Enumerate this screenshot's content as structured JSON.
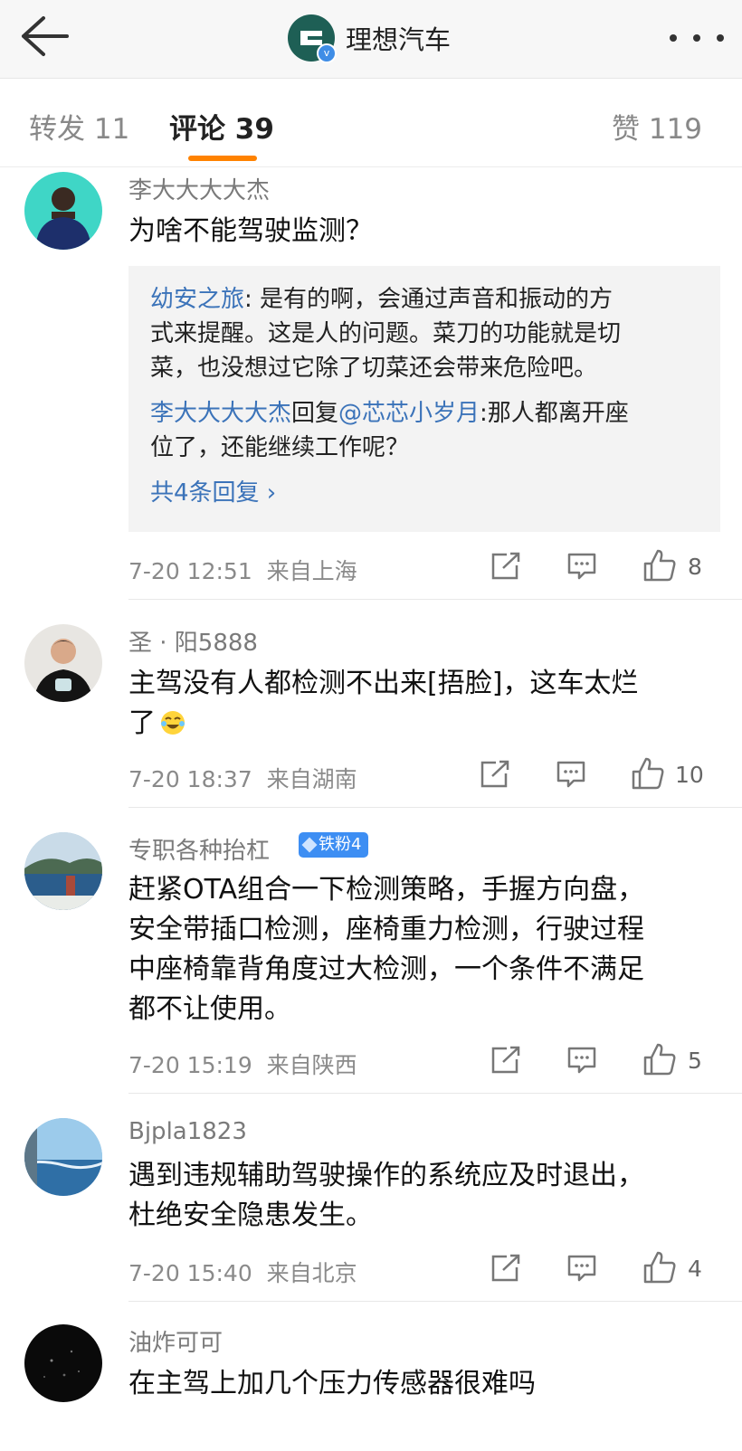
{
  "header": {
    "title": "理想汽车",
    "verified_mark": "v"
  },
  "tabs": [
    {
      "label": "转发 11"
    },
    {
      "label": "评论 39"
    },
    {
      "label": "赞 119"
    }
  ],
  "comments": [
    {
      "user": "李大大大大杰",
      "text": "为啥不能驾驶监测？",
      "replies": {
        "first_user": "幼安之旅",
        "first_text_1": ": 是有的啊，会通过声音和振动的方",
        "first_text_2": "式来提醒。这是人的问题。菜刀的功能就是切",
        "first_text_3": "菜，也没想过它除了切菜还会带来危险吧。",
        "second_user": "李大大大大杰",
        "second_mid": "回复",
        "second_mention": "@芯芯小岁月",
        "second_text_1": ":那人都离开座",
        "second_text_2": "位了，还能继续工作呢？",
        "more_label": "共4条回复 ›"
      },
      "time": "7-20 12:51",
      "location": "来自上海",
      "likes": "8"
    },
    {
      "user": "圣 · 阳5888",
      "text_1": "主驾没有人都检测不出来[捂脸]，这车太烂",
      "text_2": "了",
      "time": "7-20 18:37",
      "location": "来自湖南",
      "likes": "10"
    },
    {
      "user": "专职各种抬杠",
      "badge": "铁粉4",
      "text_1": "赶紧OTA组合一下检测策略，手握方向盘，",
      "text_2": "安全带插口检测，座椅重力检测，行驶过程",
      "text_3": "中座椅靠背角度过大检测，一个条件不满足",
      "text_4": "都不让使用。",
      "time": "7-20 15:19",
      "location": "来自陕西",
      "likes": "5"
    },
    {
      "user": "Bjpla1823",
      "text_1": "遇到违规辅助驾驶操作的系统应及时退出，",
      "text_2": "杜绝安全隐患发生。",
      "time": "7-20 15:40",
      "location": "来自北京",
      "likes": "4"
    },
    {
      "user": "油炸可可",
      "text": "在主驾上加几个压力传感器很难吗"
    }
  ],
  "colors": {
    "accent": "#ff8200",
    "link": "#3b73b9",
    "badge": "#3d8ef3"
  }
}
